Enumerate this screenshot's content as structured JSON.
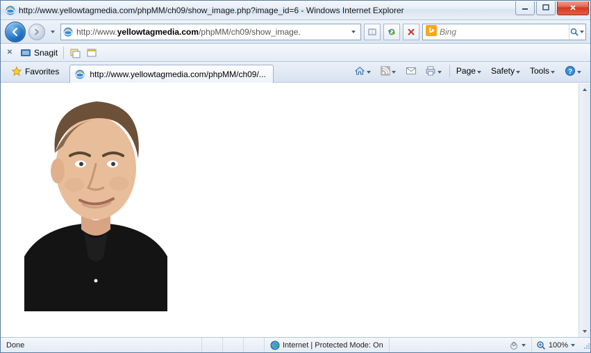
{
  "titlebar": {
    "text": "http://www.yellowtagmedia.com/phpMM/ch09/show_image.php?image_id=6 - Windows Internet Explorer"
  },
  "address": {
    "prefix": "http://www.",
    "bold": "yellowtagmedia.com",
    "suffix": "/phpMM/ch09/show_image."
  },
  "search": {
    "placeholder": "Bing"
  },
  "snagit": {
    "label": "Snagit"
  },
  "favorites": {
    "label": "Favorites"
  },
  "tab": {
    "label": "http://www.yellowtagmedia.com/phpMM/ch09/..."
  },
  "commands": {
    "page": "Page",
    "safety": "Safety",
    "tools": "Tools"
  },
  "statusbar": {
    "done": "Done",
    "security": "Internet | Protected Mode: On",
    "zoom": "100%"
  }
}
